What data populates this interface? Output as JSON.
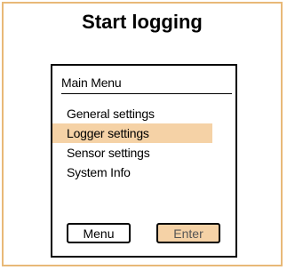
{
  "title": "Start logging",
  "screen": {
    "header": "Main Menu",
    "items": [
      {
        "label": "General settings"
      },
      {
        "label": "Logger settings"
      },
      {
        "label": "Sensor settings"
      },
      {
        "label": "System Info"
      }
    ],
    "selected_index": 1
  },
  "buttons": {
    "menu_label": "Menu",
    "enter_label": "Enter"
  },
  "colors": {
    "frame_border": "#e8b978",
    "highlight": "#f5d2a6"
  }
}
